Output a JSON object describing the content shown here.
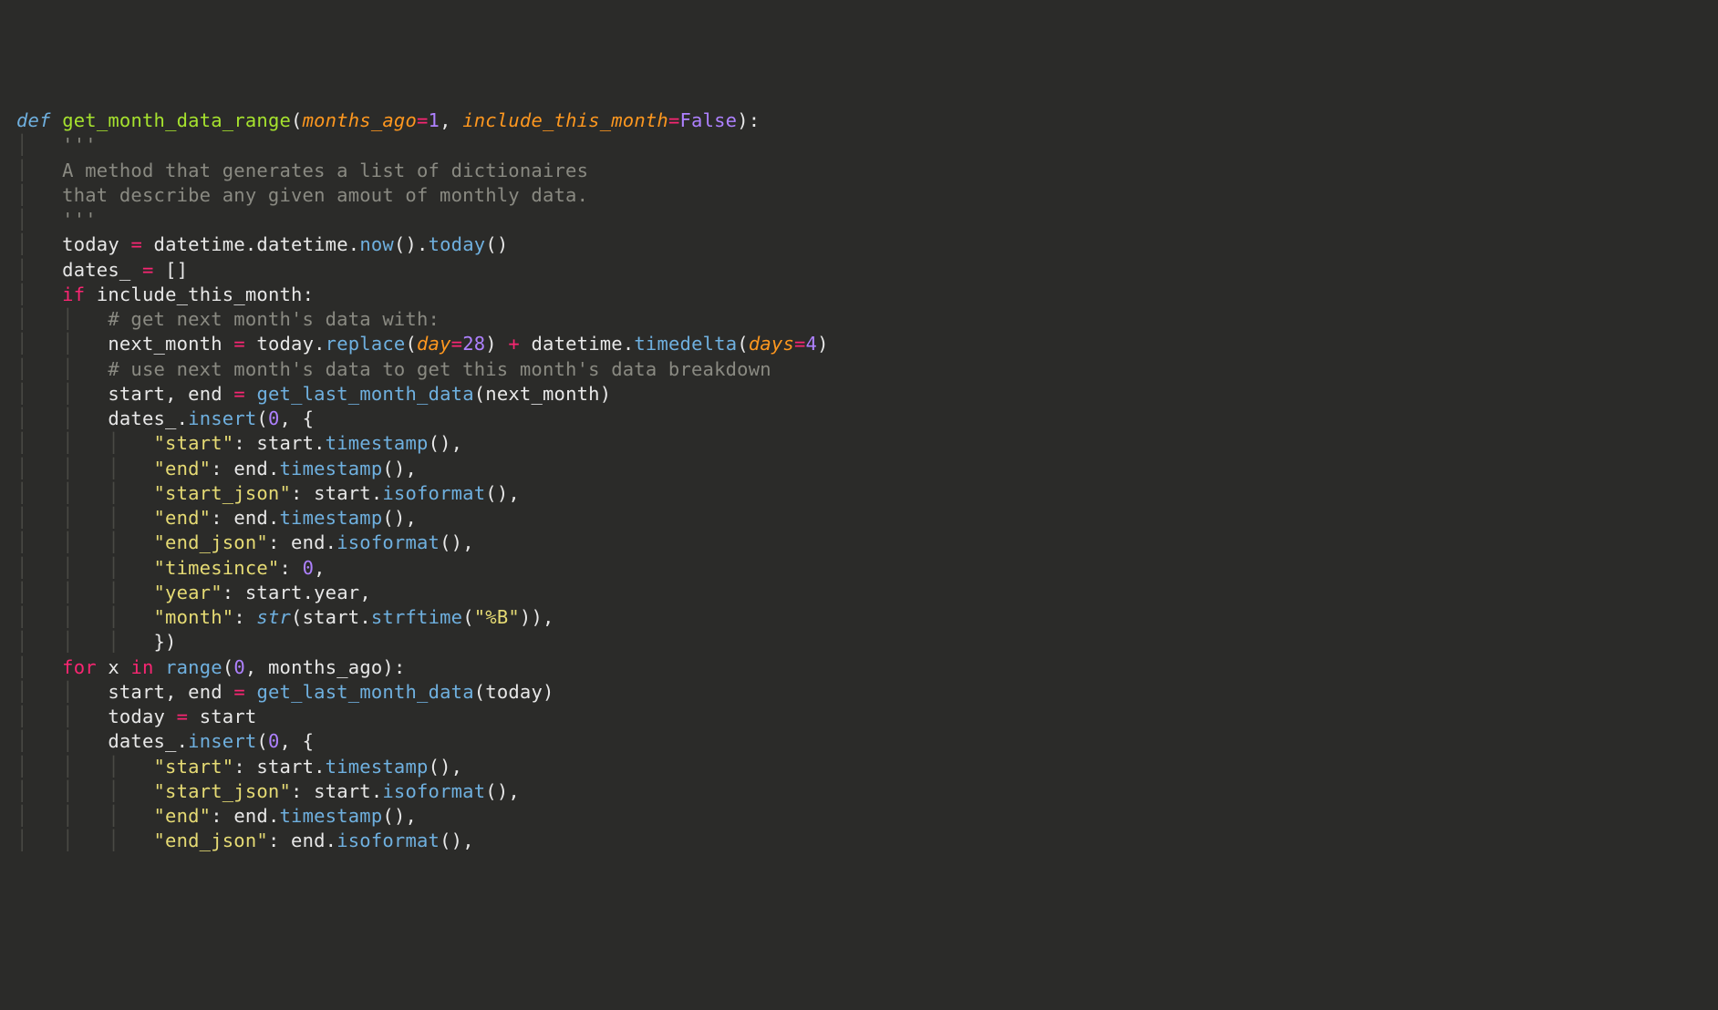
{
  "code": {
    "line1": {
      "def": "def",
      "fn": "get_month_data_range",
      "p1": "months_ago",
      "v1": "1",
      "p2": "include_this_month",
      "v2": "False"
    },
    "doc1": "'''",
    "doc2": "A method that generates a list of dictionaires",
    "doc3": "that describe any given amout of monthly data.",
    "doc4": "'''",
    "ln_today": {
      "ident": "today",
      "mod": "datetime",
      "cls": "datetime",
      "now": "now",
      "today": "today"
    },
    "ln_dates": "dates_",
    "ln_if": {
      "kw": "if",
      "ident": "include_this_month"
    },
    "cm1": "# get next month's data with:",
    "ln_nextmonth": {
      "ident": "next_month",
      "today": "today",
      "replace": "replace",
      "day": "day",
      "v28": "28",
      "dt": "datetime",
      "td": "timedelta",
      "days": "days",
      "v4": "4"
    },
    "cm2": "# use next month's data to get this month's data breakdown",
    "ln_se1": {
      "s": "start",
      "e": "end",
      "fn": "get_last_month_data",
      "arg": "next_month"
    },
    "ln_ins1": {
      "d": "dates_",
      "ins": "insert",
      "z": "0"
    },
    "k_start": "\"start\"",
    "k_end": "\"end\"",
    "k_startjson": "\"start_json\"",
    "k_endjson": "\"end_json\"",
    "k_timesince": "\"timesince\"",
    "k_year": "\"year\"",
    "k_month": "\"month\"",
    "m_timestamp": "timestamp",
    "m_isoformat": "isoformat",
    "m_strftime": "strftime",
    "id_start": "start",
    "id_end": "end",
    "id_year": "year",
    "str_B": "\"%B\"",
    "z": "0",
    "ln_for": {
      "for": "for",
      "x": "x",
      "in": "in",
      "range": "range",
      "z": "0",
      "ma": "months_ago"
    },
    "ln_se2": {
      "fn": "get_last_month_data",
      "arg": "today"
    },
    "ln_ta": {
      "today": "today",
      "start": "start"
    },
    "builtin_str": "str"
  }
}
